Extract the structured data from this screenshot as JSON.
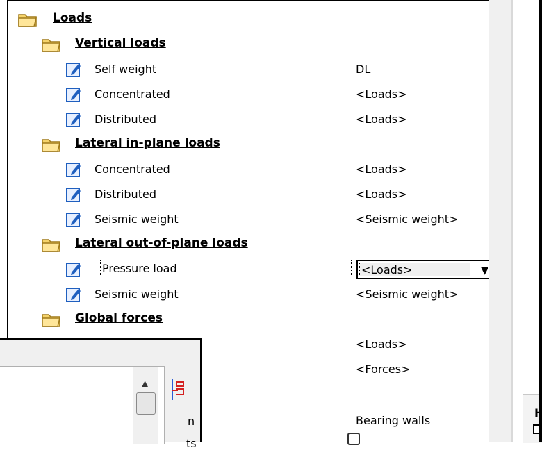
{
  "tree": {
    "root": {
      "label": "Loads",
      "icon": "folder-icon"
    },
    "groups": [
      {
        "label": "Vertical loads",
        "items": [
          {
            "label": "Self weight",
            "value": "DL"
          },
          {
            "label": "Concentrated",
            "value": "<Loads>"
          },
          {
            "label": "Distributed",
            "value": "<Loads>"
          }
        ]
      },
      {
        "label": "Lateral in-plane loads",
        "items": [
          {
            "label": "Concentrated",
            "value": "<Loads>"
          },
          {
            "label": "Distributed",
            "value": "<Loads>"
          },
          {
            "label": "Seismic weight",
            "value": "<Seismic weight>"
          }
        ]
      },
      {
        "label": "Lateral out-of-plane loads",
        "items": [
          {
            "label": "Pressure load",
            "value": "<Loads>",
            "selected": true
          },
          {
            "label": "Seismic weight",
            "value": "<Seismic weight>"
          }
        ]
      },
      {
        "label": "Global forces",
        "items": [
          {
            "label": "",
            "value": "<Loads>"
          },
          {
            "label": "",
            "value": "<Forces>"
          }
        ]
      }
    ],
    "extra_rows": [
      {
        "label_fragment": "n",
        "value": "Bearing walls"
      },
      {
        "label_fragment": "ts",
        "value": ""
      }
    ]
  },
  "right_tab": {
    "label": "H"
  },
  "colors": {
    "folder": "#f5d36a",
    "doc_icon": "#1f5fbf",
    "background": "#ffffff",
    "panel_gray": "#f0f0f0"
  }
}
